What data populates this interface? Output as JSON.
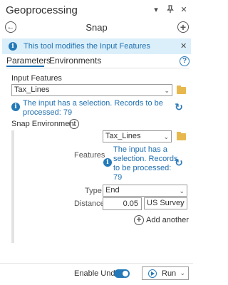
{
  "pane": {
    "title": "Geoprocessing",
    "controls": {
      "menu": "▾",
      "pin": "📌",
      "close": "✕"
    }
  },
  "tool": {
    "back_glyph": "←",
    "name": "Snap",
    "add_glyph": "+"
  },
  "banner": {
    "text": "This tool modifies the Input Features",
    "close": "✕"
  },
  "tabs": [
    {
      "label": "Parameters",
      "active": true
    },
    {
      "label": "Environments",
      "active": false
    }
  ],
  "help_glyph": "?",
  "input_features": {
    "label": "Input Features",
    "value": "Tax_Lines",
    "message": "The input has a selection. Records to be processed: 79",
    "message_lines": [
      "The input has a selection. Records to be",
      "processed: 79"
    ]
  },
  "snap_environment": {
    "label": "Snap Environment",
    "features_label": "Features",
    "features_value": "Tax_Lines",
    "message_lines": [
      "The input has a",
      "selection. Records",
      "to be processed:",
      "79"
    ],
    "type_label": "Type",
    "type_value": "End",
    "distance_label": "Distance",
    "distance_value": "0.05",
    "distance_unit": "US Survey",
    "add_another": "Add another"
  },
  "footer": {
    "enable_undo_label": "Enable Undo",
    "enable_undo_on": true,
    "run_label": "Run"
  },
  "colors": {
    "accent": "#2479b8",
    "banner_bg": "#dbeffa",
    "folder": "#e7b84e"
  }
}
